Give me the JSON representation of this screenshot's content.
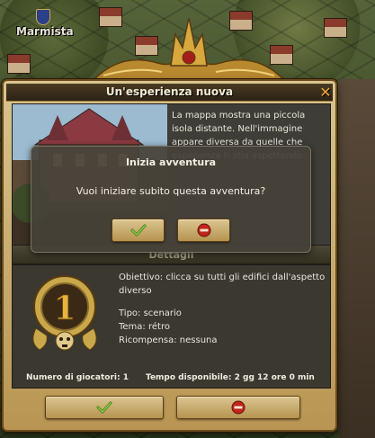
{
  "map": {
    "player_name": "Marmista"
  },
  "dialog": {
    "title": "Un'esperienza nuova",
    "description": "La mappa mostra una piccola isola distante. Nell'immagine appare diversa da quelle che esperienza ti stia aspettando."
  },
  "confirm": {
    "title": "Inizia avventura",
    "question": "Vuoi iniziare subito questa avventura?"
  },
  "details": {
    "header": "Dettagli",
    "difficulty": "1",
    "objective": "Obiettivo: clicca su tutti gli edifici dall'aspetto diverso",
    "type": "Tipo: scenario",
    "theme": "Tema: rétro",
    "reward": "Ricompensa: nessuna",
    "players": "Numero di giocatori: 1",
    "time": "Tempo disponibile: 2 gg 12 ore 0 min"
  },
  "icons": {
    "accept": "check-icon",
    "decline": "no-entry-icon",
    "close": "close-icon",
    "medal": "skull-medal-icon"
  },
  "colors": {
    "accept_green": "#5c9e2a",
    "decline_red": "#c0261c",
    "gold": "#c9a84b"
  }
}
